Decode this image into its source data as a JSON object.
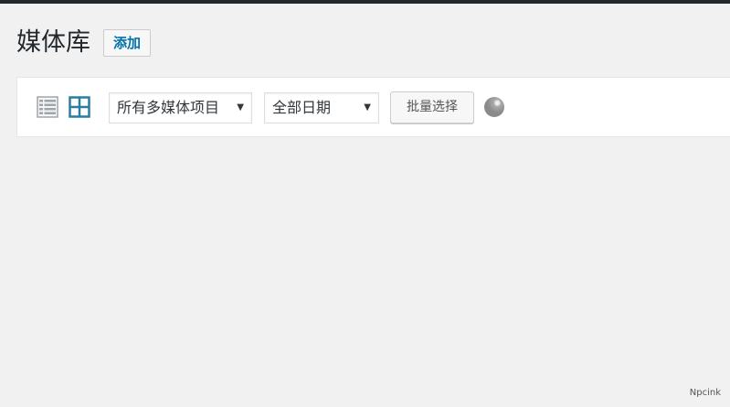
{
  "page": {
    "title": "媒体库",
    "add_button": "添加"
  },
  "toolbar": {
    "view_modes": [
      {
        "name": "list",
        "icon": "list-view-icon",
        "active": false
      },
      {
        "name": "grid",
        "icon": "grid-view-icon",
        "active": true
      }
    ],
    "type_filter": {
      "selected": "所有多媒体项目"
    },
    "date_filter": {
      "selected": "全部日期"
    },
    "bulk_select_button": "批量选择"
  },
  "watermark": "Npcink",
  "colors": {
    "accent": "#0073aa",
    "active_icon": "#2a7da0",
    "inactive_icon": "#a0a5aa",
    "background": "#f1f1f1",
    "topbar": "#23282d"
  }
}
